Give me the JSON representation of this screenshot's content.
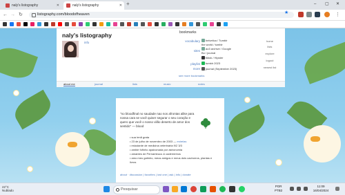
{
  "browser": {
    "tabs": [
      {
        "label": "naly's listography",
        "active": false
      },
      {
        "label": "naly's listography",
        "active": true
      }
    ],
    "url": "listography.com/bloodofheaven",
    "window_controls": [
      "–",
      "▢",
      "✕"
    ]
  },
  "profile": {
    "title": "naly's listography",
    "sub_link": "info"
  },
  "bookmarks": {
    "header": "bookmarks",
    "rows": [
      {
        "label": "vocabulary",
        "entries": [
          "helvetica / Tumblr",
          "the world / tumblr"
        ]
      },
      {
        "label": "sites",
        "entries": [
          "ao3 archive / Google",
          "Bo / journal"
        ]
      },
      {
        "label": "",
        "entries": [
          "tiktok / Hipster"
        ]
      },
      {
        "label": "playlist",
        "entries": [
          "tumblr 2023"
        ]
      },
      {
        "label": "more",
        "entries": [
          "journal (September 2023)"
        ]
      }
    ],
    "more_link": "see more bookmarks"
  },
  "right_nav": [
    "home",
    "lists",
    "explore",
    "logout",
    "newest list"
  ],
  "subnav": [
    "about me",
    "journal",
    "lists",
    "music",
    "notes"
  ],
  "content": {
    "quote": "\"no bloodfinal no saudade nao nos afrontas alike para nossa cara se você quiser segurar o seu coração e quero que você o nosso vilão deserto de amor dos sentido\"",
    "attribution": "— blood",
    "list": [
      {
        "text": "sua irmã grata",
        "link": ""
      },
      {
        "text": "23 de julho de novembro de 2003 —",
        "link": "estrelas"
      },
      {
        "text": "estudante de medicina veterinária 9/2 3/3",
        "link": ""
      },
      {
        "text": "ambie fofinho apaixonada por astronomia",
        "link": ""
      },
      {
        "text": "amantes de Pernambuco & caderninhos",
        "link": ""
      },
      {
        "text": "amo meu gatinho, meus amigos e meus dois cachorros, plantas e livros",
        "link": ""
      }
    ],
    "footer_links": [
      "about · discussion",
      "favorites",
      "lost one",
      "ask",
      "info",
      "donate"
    ]
  },
  "taskbar": {
    "weather": [
      "22°C",
      "Nublado"
    ],
    "search_placeholder": "Pesquisar",
    "tray_lang": [
      "POR",
      "PTB2"
    ],
    "time": "11:09",
    "date": "16/04/2024"
  }
}
